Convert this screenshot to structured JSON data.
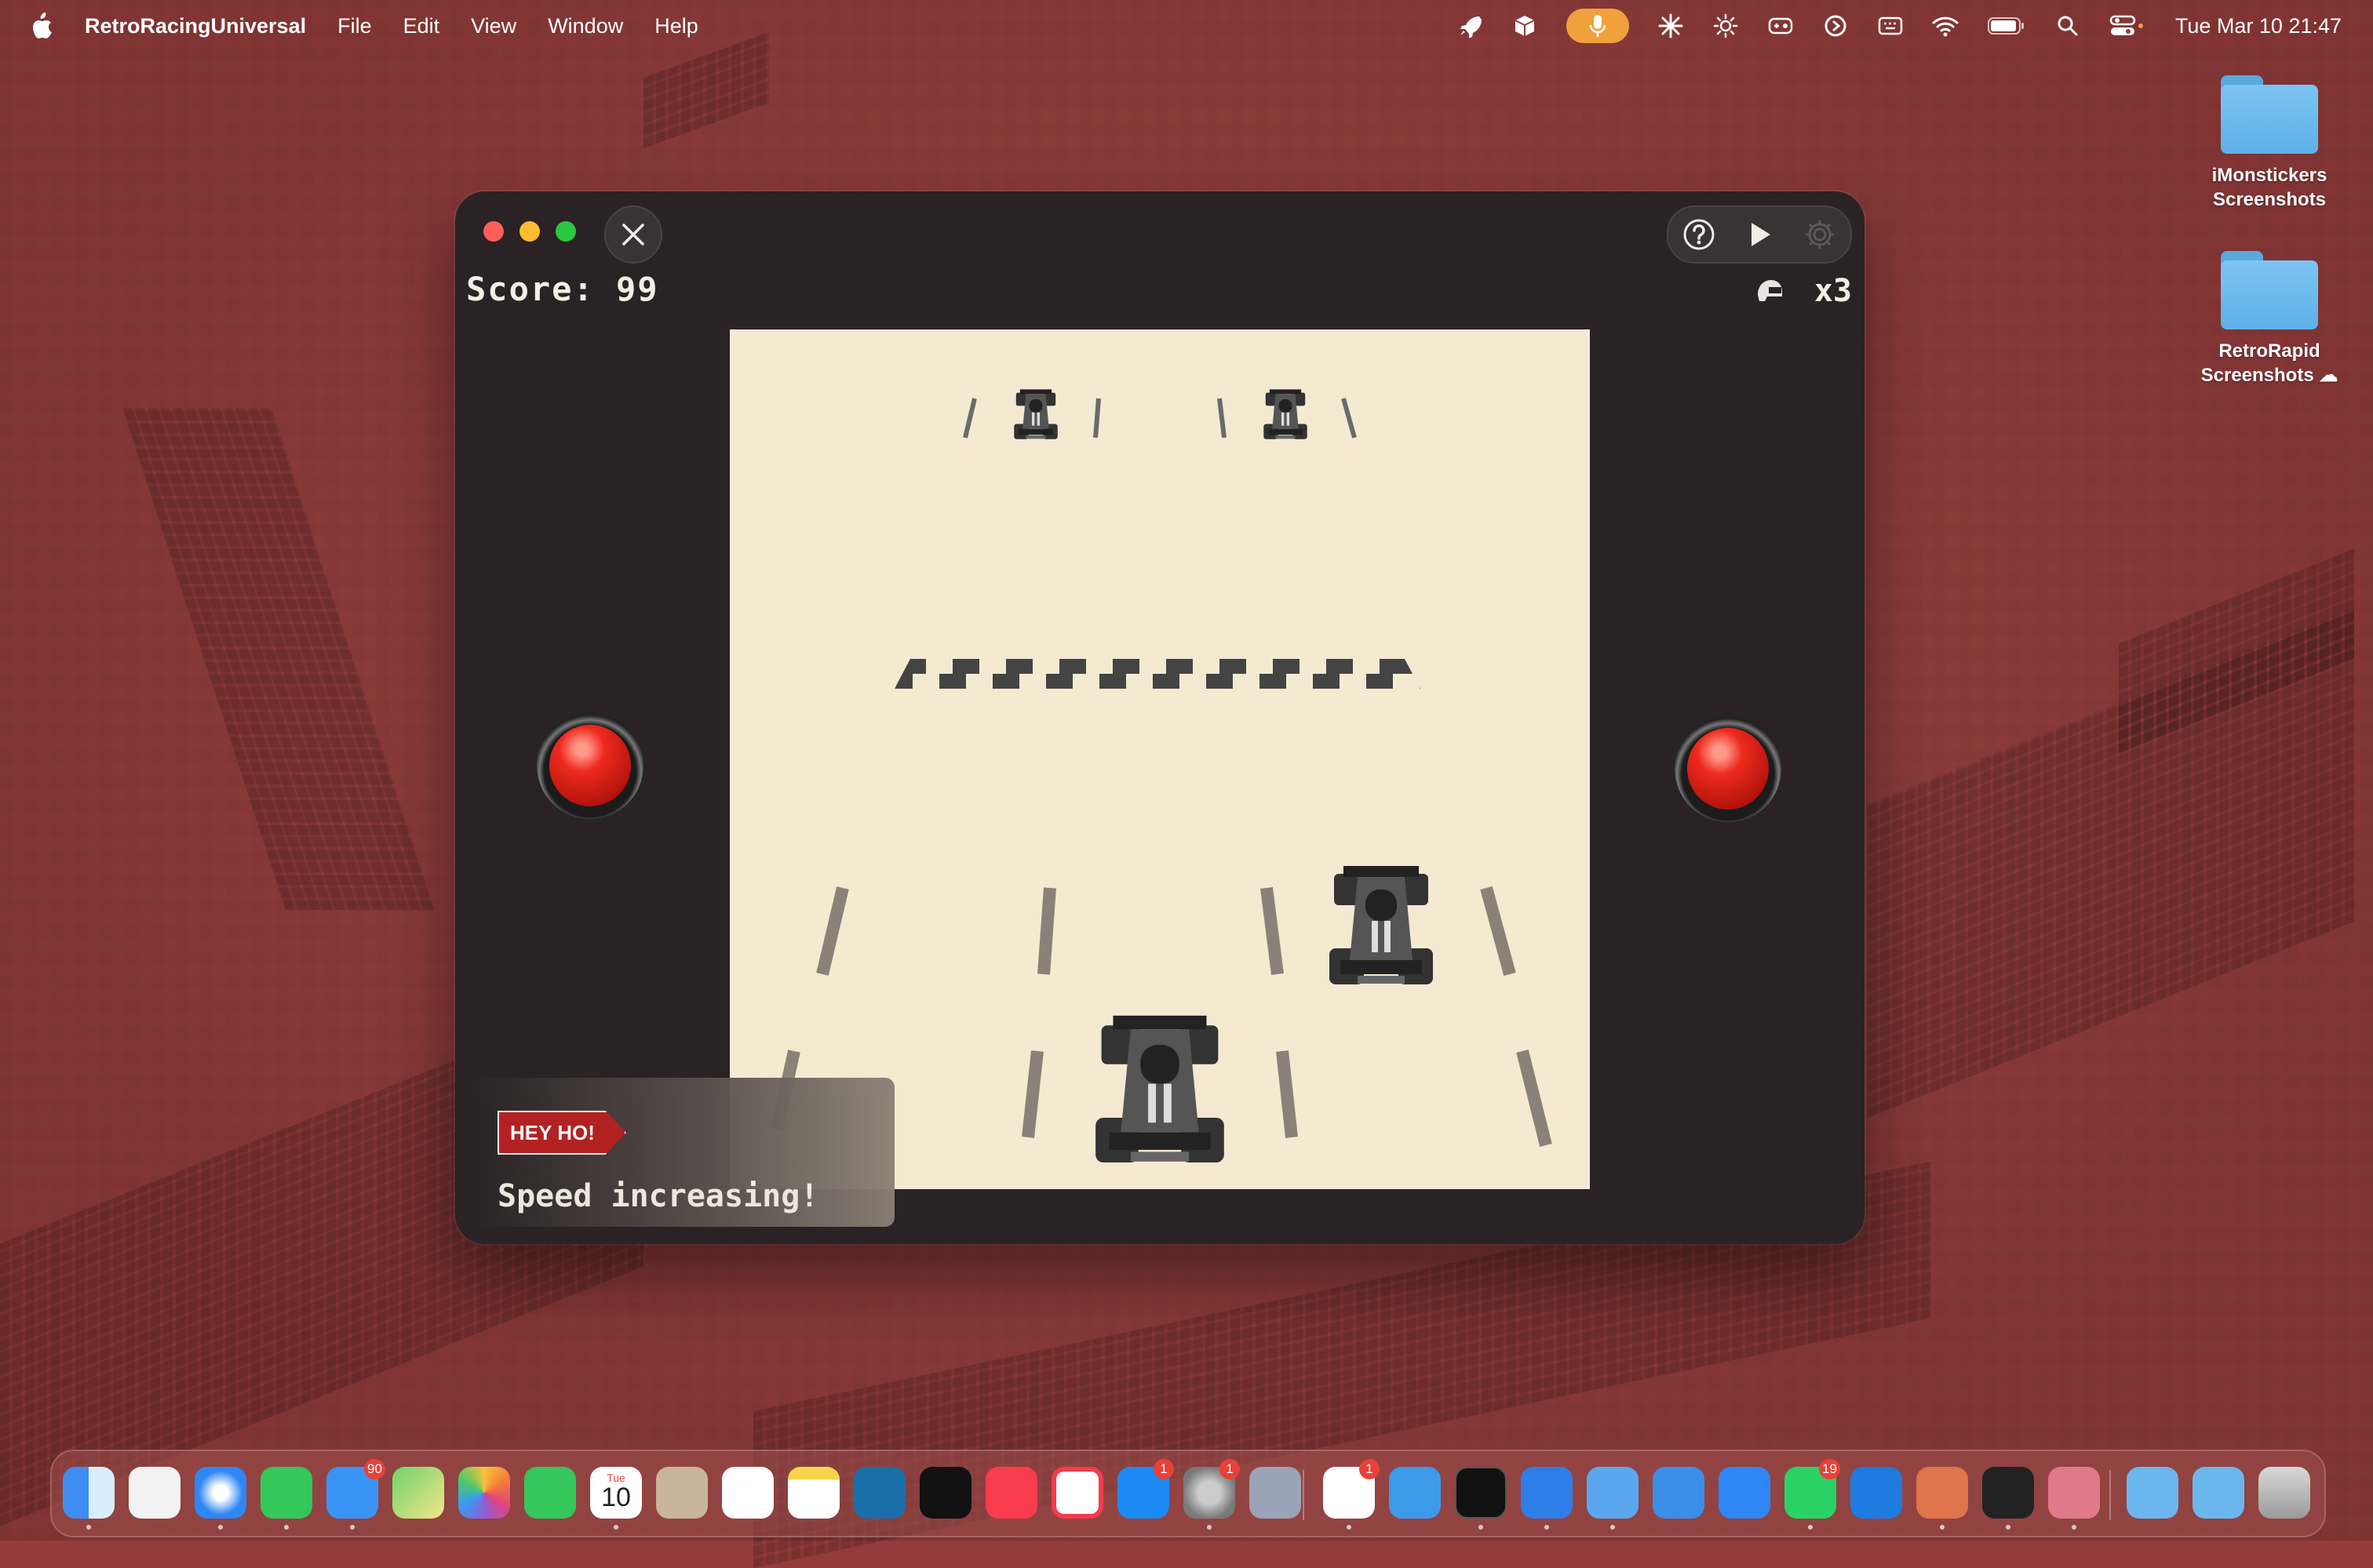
{
  "menubar": {
    "app_name": "RetroRacingUniversal",
    "items": [
      "File",
      "Edit",
      "View",
      "Window",
      "Help"
    ],
    "clock": "Tue Mar 10  21:47"
  },
  "desktop": {
    "icons": [
      {
        "label_line1": "iMonstickers",
        "label_line2": "Screenshots"
      },
      {
        "label_line1": "RetroRapid",
        "label_line2": "Screenshots ☁"
      }
    ]
  },
  "game": {
    "score_text": "Score: 99",
    "lives_text": "x3",
    "toast_badge": "HEY HO!",
    "toast_message": "Speed increasing!"
  },
  "dock": {
    "calendar_month": "Tue",
    "calendar_day": "10",
    "badges": {
      "mail": "90",
      "app_store": "1",
      "settings": "1",
      "slack": "1",
      "whatsapp": "19"
    }
  },
  "colors": {
    "wallpaper": "#943c3b",
    "window_bg": "#2a2224",
    "screen_bg": "#f4ead2",
    "red_button": "#ee2a1e",
    "mic_pill": "#f1a13b"
  }
}
